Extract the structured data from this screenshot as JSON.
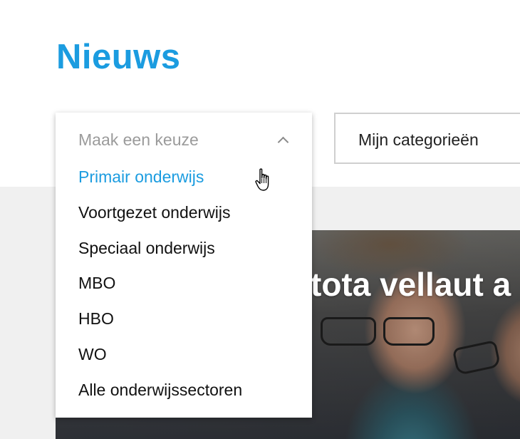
{
  "page": {
    "title": "Nieuws"
  },
  "sector_select": {
    "placeholder": "Maak een keuze",
    "options": [
      {
        "label": "Primair onderwijs",
        "hovered": true
      },
      {
        "label": "Voortgezet onderwijs"
      },
      {
        "label": "Speciaal onderwijs"
      },
      {
        "label": "MBO"
      },
      {
        "label": "HBO"
      },
      {
        "label": "WO"
      },
      {
        "label": "Alle onderwijssectoren"
      }
    ]
  },
  "category_button": {
    "label": "Mijn categorieën"
  },
  "hero": {
    "title_fragment": "tota vellaut a"
  },
  "icons": {
    "chevron": "chevron-up-icon",
    "cursor": "hand-pointer-icon"
  },
  "colors": {
    "accent": "#1b9ce0",
    "text": "#111111",
    "placeholder": "#9b9b9b",
    "page_background": "#f0f0f0"
  }
}
